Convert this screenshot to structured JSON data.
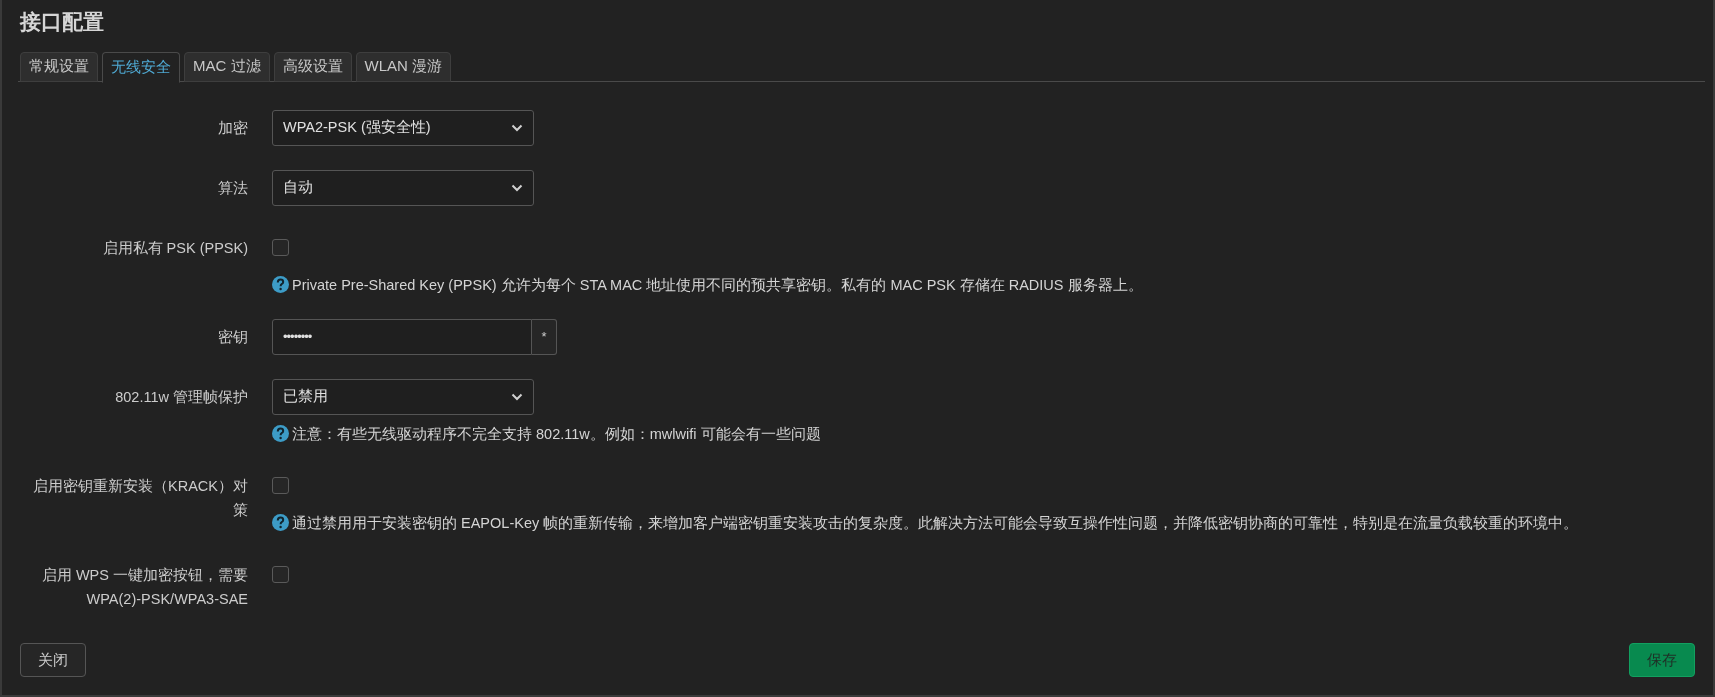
{
  "title": "接口配置",
  "tabs": [
    {
      "label": "常规设置",
      "selected": false
    },
    {
      "label": "无线安全",
      "selected": true
    },
    {
      "label": "MAC 过滤",
      "selected": false
    },
    {
      "label": "高级设置",
      "selected": false
    },
    {
      "label": "WLAN 漫游",
      "selected": false
    }
  ],
  "fields": [
    {
      "kind": "select",
      "label": "加密",
      "value": "WPA2-PSK (强安全性)"
    },
    {
      "kind": "select",
      "label": "算法",
      "value": "自动"
    },
    {
      "kind": "checkbox",
      "label": "启用私有 PSK (PPSK)",
      "checked": false,
      "help": "Private Pre-Shared Key (PPSK) 允许为每个 STA MAC 地址使用不同的预共享密钥。私有的 MAC PSK 存储在 RADIUS 服务器上。"
    },
    {
      "kind": "password",
      "label": "密钥",
      "value": "••••••••",
      "reveal": "*"
    },
    {
      "kind": "select",
      "label": "802.11w 管理帧保护",
      "value": "已禁用",
      "help": "注意：有些无线驱动程序不完全支持 802.11w。例如：mwlwifi 可能会有一些问题"
    },
    {
      "kind": "checkbox",
      "label": "启用密钥重新安装（KRACK）对策",
      "checked": false,
      "help": "通过禁用用于安装密钥的 EAPOL-Key 帧的重新传输，来增加客户端密钥重安装攻击的复杂度。此解决方法可能会导致互操作性问题，并降低密钥协商的可靠性，特别是在流量负载较重的环境中。"
    },
    {
      "kind": "checkbox",
      "label": "启用 WPS 一键加密按钮，需要 WPA(2)-PSK/WPA3-SAE",
      "checked": false
    }
  ],
  "buttons": {
    "close": "关闭",
    "save": "保存"
  }
}
